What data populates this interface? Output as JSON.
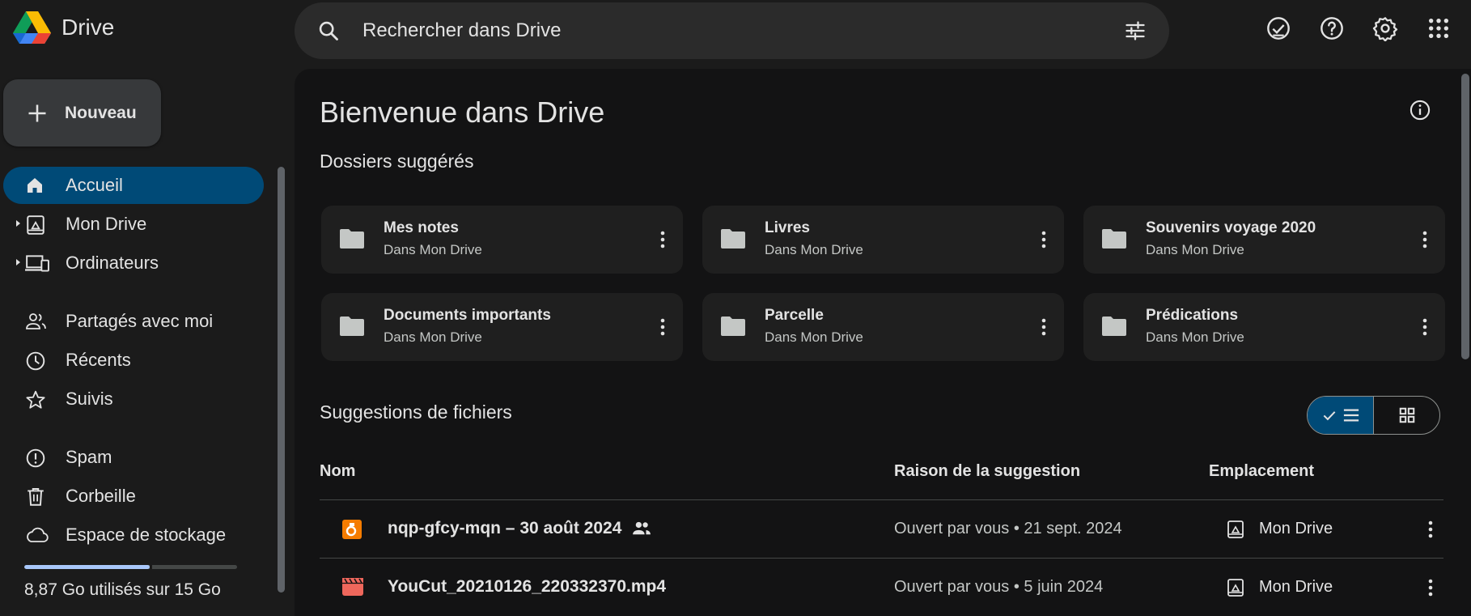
{
  "app": {
    "name": "Drive"
  },
  "search": {
    "placeholder": "Rechercher dans Drive"
  },
  "header_icons": [
    "ready-for-offline-icon",
    "help-icon",
    "settings-icon",
    "apps-grid-icon"
  ],
  "sidebar": {
    "new_label": "Nouveau",
    "items": [
      {
        "label": "Accueil",
        "icon": "home-icon",
        "active": true
      },
      {
        "label": "Mon Drive",
        "icon": "my-drive-icon"
      },
      {
        "label": "Ordinateurs",
        "icon": "computers-icon"
      },
      {
        "label": "Partagés avec moi",
        "icon": "shared-icon"
      },
      {
        "label": "Récents",
        "icon": "clock-icon"
      },
      {
        "label": "Suivis",
        "icon": "star-icon"
      },
      {
        "label": "Spam",
        "icon": "spam-icon"
      },
      {
        "label": "Corbeille",
        "icon": "trash-icon"
      },
      {
        "label": "Espace de stockage",
        "icon": "cloud-icon"
      }
    ],
    "storage": {
      "text": "8,87 Go utilisés sur 15 Go",
      "used_fraction": 0.59
    }
  },
  "main": {
    "title": "Bienvenue dans Drive",
    "suggested_folders_title": "Dossiers suggérés",
    "folders": [
      {
        "name": "Mes notes",
        "location": "Dans Mon Drive"
      },
      {
        "name": "Livres",
        "location": "Dans Mon Drive"
      },
      {
        "name": "Souvenirs voyage 2020",
        "location": "Dans Mon Drive"
      },
      {
        "name": "Documents importants",
        "location": "Dans Mon Drive"
      },
      {
        "name": "Parcelle",
        "location": "Dans Mon Drive"
      },
      {
        "name": "Prédications",
        "location": "Dans Mon Drive"
      }
    ],
    "suggested_files_title": "Suggestions de fichiers",
    "columns": {
      "name": "Nom",
      "reason": "Raison de la suggestion",
      "location": "Emplacement"
    },
    "files": [
      {
        "name": "nqp-gfcy-mqn – 30 août 2024",
        "icon": "meet-recording-icon",
        "shared": true,
        "reason": "Ouvert par vous • 21 sept. 2024",
        "location": "Mon Drive"
      },
      {
        "name": "YouCut_20210126_220332370.mp4",
        "icon": "video-file-icon",
        "shared": false,
        "reason": "Ouvert par vous • 5 juin 2024",
        "location": "Mon Drive"
      }
    ]
  },
  "colors": {
    "background": "#1b1b1b",
    "surface": "#131314",
    "active_nav": "#004a77",
    "card": "#1f1f1f",
    "storage_fill": "#a8c7fa",
    "meet_orange": "#f57c00",
    "video_red": "#ee675c"
  }
}
